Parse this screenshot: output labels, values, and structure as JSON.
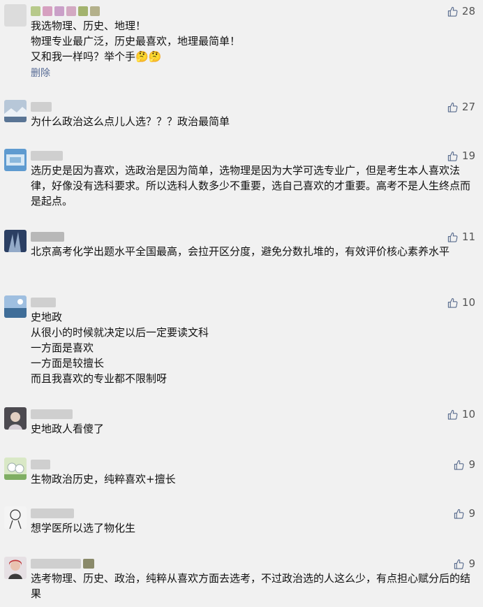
{
  "comments": [
    {
      "likes": "28",
      "text": "我选物理、历史、地理！\n物理专业最广泛，历史最喜欢，地理最简单！\n又和我一样吗？举个手🤔🤔",
      "action": "删除"
    },
    {
      "likes": "27",
      "text": "为什么政治这么点儿人选？？？政治最简单"
    },
    {
      "likes": "19",
      "text": "选历史是因为喜欢，选政治是因为简单，选物理是因为大学可选专业广，但是考生本人喜欢法律，好像没有选科要求。所以选科人数多少不重要，选自己喜欢的才重要。高考不是人生终点而是起点。"
    },
    {
      "likes": "11",
      "text": "北京高考化学出题水平全国最高，会拉开区分度，避免分数扎堆的，有效评价核心素养水平"
    },
    {
      "likes": "10",
      "text": "史地政\n从很小的时候就决定以后一定要读文科\n一方面是喜欢\n一方面是较擅长\n而且我喜欢的专业都不限制呀"
    },
    {
      "likes": "10",
      "text": "史地政人看傻了"
    },
    {
      "likes": "9",
      "text": "生物政治历史，纯粹喜欢+擅长"
    },
    {
      "likes": "9",
      "text": "想学医所以选了物化生"
    },
    {
      "likes": "9",
      "text": "选考物理、历史、政治，纯粹从喜欢方面去选考，不过政治选的人这么少，有点担心赋分后的结果"
    }
  ],
  "icons": {
    "like": "thumbs-up-icon"
  },
  "colors": {
    "link": "#576b95",
    "background": "#f1f1f1"
  }
}
